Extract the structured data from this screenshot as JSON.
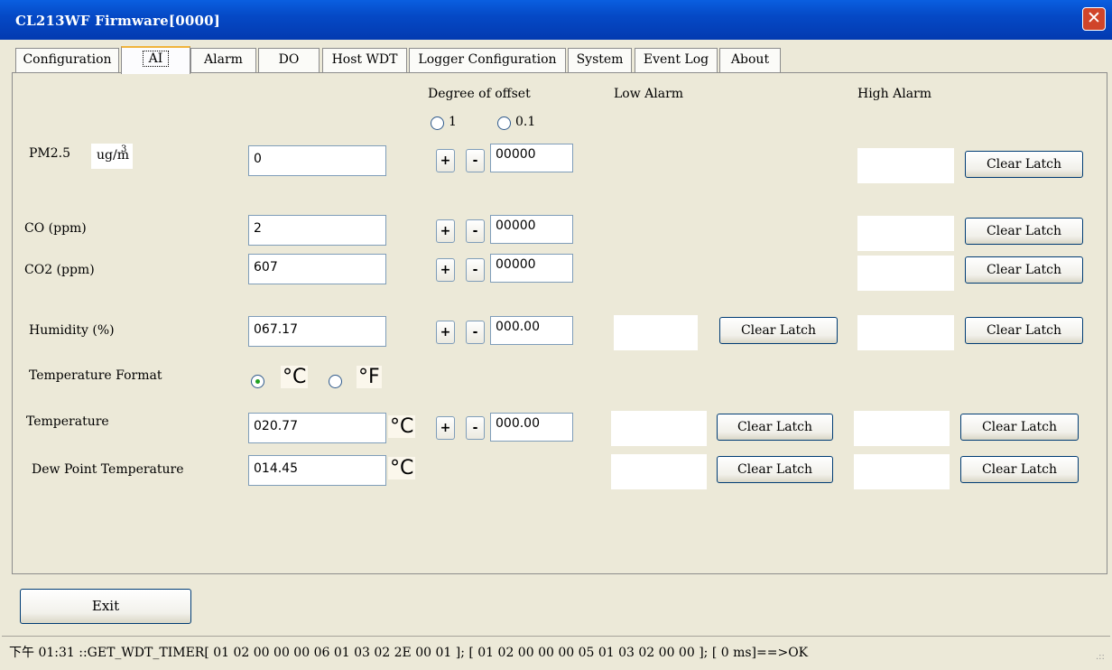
{
  "window": {
    "title": "CL213WF Firmware[0000]",
    "close_glyph": "✕"
  },
  "tabs": [
    "Configuration",
    "AI",
    "Alarm",
    "DO",
    "Host WDT",
    "Logger Configuration",
    "System",
    "Event Log",
    "About"
  ],
  "active_tab": "AI",
  "headers": {
    "degree_of_offset": "Degree of offset",
    "low_alarm": "Low Alarm",
    "high_alarm": "High Alarm"
  },
  "offset_options": {
    "opt1": "1",
    "opt2": "0.1"
  },
  "plus": "+",
  "minus": "-",
  "clear_latch": "Clear Latch",
  "rows": {
    "pm25": {
      "label": "PM2.5",
      "unit": "ug/m",
      "unit_sup": "3",
      "value": "0",
      "offset": "00000"
    },
    "co": {
      "label": "CO (ppm)",
      "value": "2",
      "offset": "00000"
    },
    "co2": {
      "label": "CO2 (ppm)",
      "value": "607",
      "offset": "00000"
    },
    "humidity": {
      "label": "Humidity (%)",
      "value": "067.17",
      "offset": "000.00"
    },
    "temp_format": {
      "label": "Temperature Format",
      "celsius": "°C",
      "fahrenheit": "°F",
      "selected": "°C"
    },
    "temperature": {
      "label": "Temperature",
      "value": "020.77",
      "unit": "°C",
      "offset": "000.00"
    },
    "dew_point": {
      "label": "Dew Point Temperature",
      "value": "014.45",
      "unit": "°C"
    }
  },
  "exit_label": "Exit",
  "status": "下午 01:31 ::GET_WDT_TIMER[ 01 02 00 00 00 06 01 03 02 2E 00 01 ]; [ 01 02 00 00 00 05 01 03 02 00 00 ]; [ 0 ms]==>OK",
  "grip": ".::"
}
